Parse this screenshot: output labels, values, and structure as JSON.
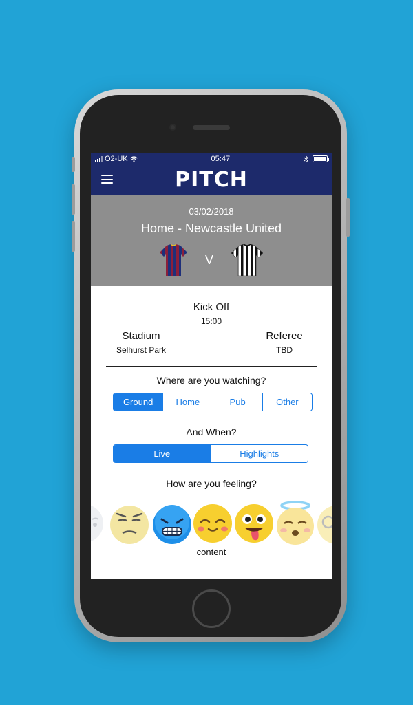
{
  "status": {
    "carrier": "O2-UK",
    "time": "05:47"
  },
  "app": {
    "title": "PITCH"
  },
  "match": {
    "date": "03/02/2018",
    "title": "Home - Newcastle United",
    "vs": "V",
    "home_kit": {
      "primary": "#8b1f3a",
      "secondary": "#1e2f7a"
    },
    "away_kit": {
      "primary": "#111111",
      "secondary": "#ffffff"
    }
  },
  "details": {
    "kickoff_label": "Kick Off",
    "kickoff_time": "15:00",
    "stadium_label": "Stadium",
    "stadium_value": "Selhurst Park",
    "referee_label": "Referee",
    "referee_value": "TBD"
  },
  "watch": {
    "question": "Where are you watching?",
    "options": [
      "Ground",
      "Home",
      "Pub",
      "Other"
    ],
    "selected": "Ground"
  },
  "when": {
    "question": "And When?",
    "options": [
      "Live",
      "Highlights"
    ],
    "selected": "Live"
  },
  "feeling": {
    "question": "How are you feeling?",
    "selected_label": "content",
    "emojis": [
      "pale",
      "annoyed",
      "cold",
      "content",
      "silly",
      "angel",
      "nerd"
    ]
  },
  "colors": {
    "nav": "#1d2a6b",
    "header": "#8e8e8e",
    "accent": "#1a7de6",
    "background": "#21a3d6"
  }
}
